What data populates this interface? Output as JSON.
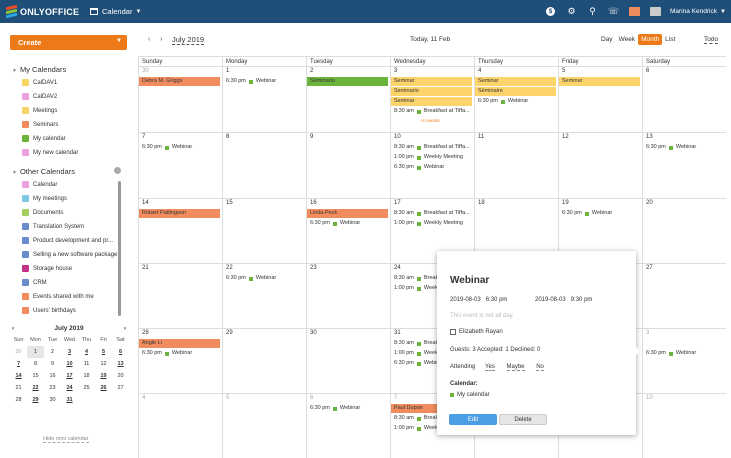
{
  "app": {
    "logo": "ONLYOFFICE",
    "module": "Calendar",
    "user": "Marina Kendrick"
  },
  "colors": {
    "topbar": "#1f4e78",
    "accent": "#ee7a17",
    "seminar": "#fdd36b",
    "person": "#f08c5e",
    "green": "#6bb33b"
  },
  "sidebar": {
    "create_label": "Create",
    "my_title": "My Calendars",
    "my_calendars": [
      {
        "label": "CalDAV1",
        "color": "#f7d564"
      },
      {
        "label": "CalDAV2",
        "color": "#e9a2dd"
      },
      {
        "label": "Meetings",
        "color": "#f7d564"
      },
      {
        "label": "Seminars",
        "color": "#f08c5e"
      },
      {
        "label": "My calendar",
        "color": "#6bb33b"
      },
      {
        "label": "My new calendar",
        "color": "#e9a2dd"
      }
    ],
    "other_title": "Other Calendars",
    "other_calendars": [
      {
        "label": "Calendar",
        "color": "#e9a2dd"
      },
      {
        "label": "My meetings",
        "color": "#80c8e8"
      },
      {
        "label": "Documents",
        "color": "#a3cf5e"
      },
      {
        "label": "Translation System",
        "color": "#6a8ccd"
      },
      {
        "label": "Product development and pr...",
        "color": "#6a8ccd"
      },
      {
        "label": "Selling a new software package",
        "color": "#6a8ccd"
      },
      {
        "label": "Storage house",
        "color": "#c3328a"
      },
      {
        "label": "CRM",
        "color": "#6a8ccd"
      },
      {
        "label": "Events shared with me",
        "color": "#f08c5e"
      },
      {
        "label": "Users' birthdays",
        "color": "#f08c5e"
      }
    ],
    "mini": {
      "month": "July 2019",
      "weekdays": [
        "Sun",
        "Mon",
        "Tue",
        "Wed",
        "Thu",
        "Fri",
        "Sat"
      ],
      "days": [
        "30",
        "1",
        "2",
        "3",
        "4",
        "5",
        "6",
        "7",
        "8",
        "9",
        "10",
        "11",
        "12",
        "13",
        "14",
        "15",
        "16",
        "17",
        "18",
        "19",
        "20",
        "21",
        "22",
        "23",
        "24",
        "25",
        "26",
        "27",
        "28",
        "29",
        "30",
        "31",
        "",
        "",
        ""
      ],
      "bold": [
        "3",
        "4",
        "5",
        "6",
        "7",
        "10",
        "13",
        "14",
        "17",
        "19",
        "22",
        "24",
        "26",
        "29",
        "31"
      ],
      "gray": [
        "30"
      ],
      "selected": "1",
      "hide_label": "Hide mini calendar"
    }
  },
  "header": {
    "month": "July 2019",
    "today": "Today, 11 Feb",
    "views": [
      "Day",
      "Week",
      "Month",
      "List"
    ],
    "active_view": "Month",
    "todo": "Todo"
  },
  "grid": {
    "weekdays": [
      "Sunday",
      "Monday",
      "Tuesday",
      "Wednesday",
      "Thursday",
      "Friday",
      "Saturday"
    ],
    "weeks": [
      [
        "30",
        "1",
        "2",
        "3",
        "4",
        "5",
        "6"
      ],
      [
        "7",
        "8",
        "9",
        "10",
        "11",
        "12",
        "13"
      ],
      [
        "14",
        "15",
        "16",
        "17",
        "18",
        "19",
        "20"
      ],
      [
        "21",
        "22",
        "23",
        "24",
        "25",
        "26",
        "27"
      ],
      [
        "28",
        "29",
        "30",
        "31",
        "1",
        "2",
        "3"
      ],
      [
        "4",
        "5",
        "6",
        "7",
        "8",
        "9",
        "10"
      ]
    ],
    "out_of_month": [
      "0-0",
      "4-4",
      "4-5",
      "4-6",
      "5-0",
      "5-1",
      "5-2",
      "5-3",
      "5-4",
      "5-5",
      "5-6"
    ],
    "events": [
      {
        "w": 0,
        "d": 0,
        "span": 1,
        "row": 0,
        "kind": "bar",
        "color": "#f08c5e",
        "text": "Debra M. Griggs"
      },
      {
        "w": 0,
        "d": 1,
        "row": 0,
        "kind": "timed",
        "text": "6:30 pm  Webinar"
      },
      {
        "w": 0,
        "d": 2,
        "span": 1,
        "row": 0,
        "kind": "bar",
        "color": "#6bb33b",
        "text": "Seminario"
      },
      {
        "w": 0,
        "d": 3,
        "span": 1,
        "row": 0,
        "kind": "bar",
        "color": "#fdd36b",
        "text": "Seminar"
      },
      {
        "w": 0,
        "d": 3,
        "span": 1,
        "row": 1,
        "kind": "bar",
        "color": "#fdd36b",
        "text": "Seminario"
      },
      {
        "w": 0,
        "d": 3,
        "span": 1,
        "row": 2,
        "kind": "bar",
        "color": "#fdd36b",
        "text": "Seminar"
      },
      {
        "w": 0,
        "d": 3,
        "row": 3,
        "kind": "timed",
        "text": "8:30 am  Breakfast at Tiffa..."
      },
      {
        "w": 0,
        "d": 4,
        "span": 1,
        "row": 0,
        "kind": "bar",
        "color": "#fdd36b",
        "text": "Seminar"
      },
      {
        "w": 0,
        "d": 4,
        "span": 1,
        "row": 1,
        "kind": "bar",
        "color": "#fdd36b",
        "text": "Séminaire"
      },
      {
        "w": 0,
        "d": 4,
        "row": 2,
        "kind": "timed",
        "text": "6:30 pm  Webinar"
      },
      {
        "w": 0,
        "d": 5,
        "span": 1,
        "row": 0,
        "kind": "bar",
        "color": "#fdd36b",
        "text": "Seminar"
      },
      {
        "w": 1,
        "d": 0,
        "row": 0,
        "kind": "timed",
        "text": "6:30 pm  Webinar"
      },
      {
        "w": 1,
        "d": 3,
        "row": 0,
        "kind": "timed",
        "text": "8:30 am  Breakfast at Tiffa..."
      },
      {
        "w": 1,
        "d": 3,
        "row": 1,
        "kind": "timed",
        "text": "1:00 pm  Weekly Meeting"
      },
      {
        "w": 1,
        "d": 3,
        "row": 2,
        "kind": "timed",
        "text": "6:30 pm  Webinar"
      },
      {
        "w": 1,
        "d": 6,
        "row": 0,
        "kind": "timed",
        "text": "6:30 pm  Webinar"
      },
      {
        "w": 2,
        "d": 0,
        "span": 1,
        "row": 0,
        "kind": "bar",
        "color": "#f08c5e",
        "text": "Robert Pattingson"
      },
      {
        "w": 2,
        "d": 2,
        "span": 1,
        "row": 0,
        "kind": "bar",
        "color": "#f08c5e",
        "text": "Linda Peck"
      },
      {
        "w": 2,
        "d": 2,
        "row": 1,
        "kind": "timed",
        "text": "6:30 pm  Webinar"
      },
      {
        "w": 2,
        "d": 3,
        "row": 0,
        "kind": "timed",
        "text": "8:30 am  Breakfast at Tiffa..."
      },
      {
        "w": 2,
        "d": 3,
        "row": 1,
        "kind": "timed",
        "text": "1:00 pm  Weekly Meeting"
      },
      {
        "w": 2,
        "d": 5,
        "row": 0,
        "kind": "timed",
        "text": "6:30 pm  Webinar"
      },
      {
        "w": 3,
        "d": 1,
        "row": 0,
        "kind": "timed",
        "text": "6:30 pm  Webinar"
      },
      {
        "w": 3,
        "d": 3,
        "row": 0,
        "kind": "timed",
        "text": "8:30 am  Breakf"
      },
      {
        "w": 3,
        "d": 3,
        "row": 1,
        "kind": "timed",
        "text": "1:00 pm  Weekl"
      },
      {
        "w": 4,
        "d": 0,
        "span": 1,
        "row": 0,
        "kind": "bar",
        "color": "#f08c5e",
        "text": "Angle Li"
      },
      {
        "w": 4,
        "d": 0,
        "row": 1,
        "kind": "timed",
        "text": "6:30 pm  Webinar"
      },
      {
        "w": 4,
        "d": 3,
        "row": 0,
        "kind": "timed",
        "text": "8:30 am  Breakf"
      },
      {
        "w": 4,
        "d": 3,
        "row": 1,
        "kind": "timed",
        "text": "1:00 pm  Weekl"
      },
      {
        "w": 4,
        "d": 3,
        "row": 2,
        "kind": "timed",
        "text": "6:30 pm  Webin"
      },
      {
        "w": 4,
        "d": 6,
        "row": 1,
        "kind": "timed",
        "text": "6:30 pm  Webinar"
      },
      {
        "w": 5,
        "d": 2,
        "row": 0,
        "kind": "timed",
        "text": "6:30 pm  Webinar"
      },
      {
        "w": 5,
        "d": 3,
        "span": 1,
        "row": 0,
        "kind": "bar",
        "color": "#f08c5e",
        "text": "Paul Dupon"
      },
      {
        "w": 5,
        "d": 3,
        "row": 1,
        "kind": "timed",
        "text": "8:30 am  Breakf"
      },
      {
        "w": 5,
        "d": 3,
        "row": 2,
        "kind": "timed",
        "text": "1:00 pm  Weekl"
      }
    ],
    "more": {
      "w": 0,
      "d": 3,
      "text": "+1 events"
    }
  },
  "popup": {
    "title": "Webinar",
    "start_date": "2019-08-03",
    "start_time": "6:30 pm",
    "end_date": "2019-08-03",
    "end_time": "9:30 pm",
    "all_day_note": "This event is not all day.",
    "organizer": "Elizabeth Rayan",
    "guests": "Guests: 3   Accepted: 1   Declined: 0",
    "attending_label": "Attending",
    "attend_options": [
      "Yes",
      "Maybe",
      "No"
    ],
    "calendar_label": "Calendar:",
    "calendar_name": "My calendar",
    "edit_label": "Edit",
    "delete_label": "Delete"
  }
}
